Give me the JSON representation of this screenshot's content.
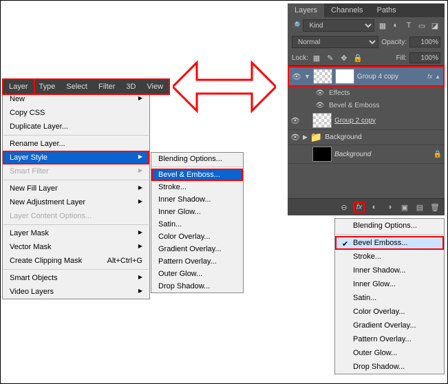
{
  "menubar": {
    "items": [
      "Layer",
      "Type",
      "Select",
      "Filter",
      "3D",
      "View"
    ],
    "active": "Layer"
  },
  "layerMenu": {
    "items": [
      {
        "label": "New",
        "arrow": true
      },
      {
        "label": "Copy CSS"
      },
      {
        "label": "Duplicate Layer..."
      },
      {
        "sep": true
      },
      {
        "label": "Rename Layer..."
      },
      {
        "label": "Layer Style",
        "arrow": true,
        "highlight": true
      },
      {
        "label": "Smart Filter",
        "arrow": true,
        "disabled": true
      },
      {
        "sep": true
      },
      {
        "label": "New Fill Layer",
        "arrow": true
      },
      {
        "label": "New Adjustment Layer",
        "arrow": true
      },
      {
        "label": "Layer Content Options...",
        "disabled": true
      },
      {
        "sep": true
      },
      {
        "label": "Layer Mask",
        "arrow": true
      },
      {
        "label": "Vector Mask",
        "arrow": true
      },
      {
        "label": "Create Clipping Mask",
        "shortcut": "Alt+Ctrl+G"
      },
      {
        "sep": true
      },
      {
        "label": "Smart Objects",
        "arrow": true
      },
      {
        "label": "Video Layers",
        "arrow": true
      }
    ]
  },
  "styleSubmenu": {
    "items": [
      {
        "label": "Blending Options..."
      },
      {
        "sep": true
      },
      {
        "label": "Bevel & Emboss...",
        "highlight": true
      },
      {
        "label": "Stroke..."
      },
      {
        "label": "Inner Shadow..."
      },
      {
        "label": "Inner Glow..."
      },
      {
        "label": "Satin..."
      },
      {
        "label": "Color Overlay..."
      },
      {
        "label": "Gradient Overlay..."
      },
      {
        "label": "Pattern Overlay..."
      },
      {
        "label": "Outer Glow..."
      },
      {
        "label": "Drop Shadow..."
      }
    ]
  },
  "layersPanel": {
    "tabs": [
      "Layers",
      "Channels",
      "Paths"
    ],
    "activeTab": "Layers",
    "kindLabel": "Kind",
    "filterIcons": [
      "▦",
      "◐",
      "T",
      "▭",
      "◪"
    ],
    "blendMode": "Normal",
    "opacityLabel": "Opacity:",
    "opacityValue": "100%",
    "lockLabel": "Lock:",
    "fillLabel": "Fill:",
    "fillValue": "100%",
    "layers": [
      {
        "name": "Group 4 copy",
        "selected": true,
        "fx": "fx",
        "eye": true,
        "thumb": "checker",
        "mask": true
      },
      {
        "name": "Effects",
        "sub": true,
        "eye": true
      },
      {
        "name": "Bevel & Emboss",
        "sub": true,
        "eye": true
      },
      {
        "name": "Group 2 copy",
        "underline": true,
        "eye": true,
        "thumb": "checker"
      },
      {
        "name": "Background",
        "folder": true,
        "eye": true
      },
      {
        "name": "Background",
        "italic": true,
        "thumb": "black",
        "lock": true
      }
    ],
    "bottomIcons": [
      "⊖",
      "fx",
      "◐",
      "▣",
      "▭",
      "▣",
      "🗑"
    ]
  },
  "fxMenu": {
    "items": [
      {
        "label": "Blending Options..."
      },
      {
        "sep": true
      },
      {
        "label": "Bevel  Emboss...",
        "highlight": true,
        "checked": true
      },
      {
        "label": "Stroke..."
      },
      {
        "label": "Inner Shadow..."
      },
      {
        "label": "Inner Glow..."
      },
      {
        "label": "Satin..."
      },
      {
        "label": "Color Overlay..."
      },
      {
        "label": "Gradient Overlay..."
      },
      {
        "label": "Pattern Overlay..."
      },
      {
        "label": "Outer Glow..."
      },
      {
        "label": "Drop Shadow..."
      }
    ]
  }
}
